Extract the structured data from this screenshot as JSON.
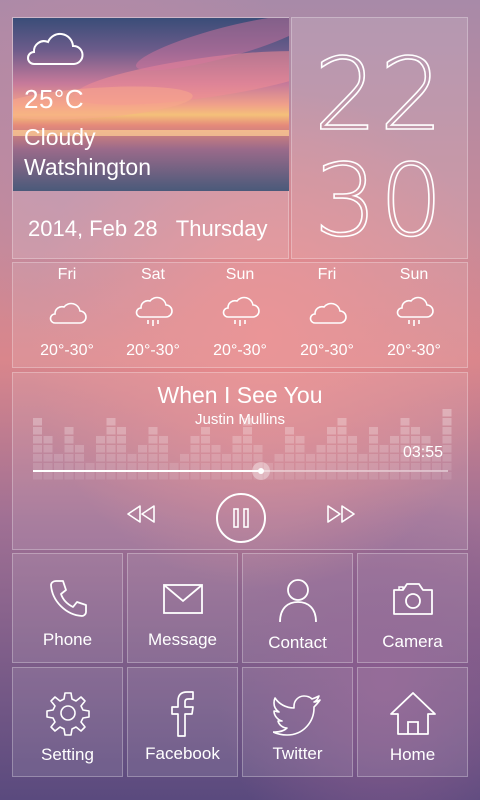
{
  "weather": {
    "temp": "25°C",
    "condition": "Cloudy",
    "city": "Watshington",
    "icon": "cloud-icon"
  },
  "date": {
    "text": "2014, Feb 28",
    "weekday": "Thursday"
  },
  "clock": {
    "hours": "22",
    "minutes": "30"
  },
  "forecast": [
    {
      "day": "Fri",
      "icon": "cloud-icon",
      "temp": "20°-30°"
    },
    {
      "day": "Sat",
      "icon": "rain-cloud-icon",
      "temp": "20°-30°"
    },
    {
      "day": "Sun",
      "icon": "rain-cloud-icon",
      "temp": "20°-30°"
    },
    {
      "day": "Fri",
      "icon": "cloud-icon",
      "temp": "20°-30°"
    },
    {
      "day": "Sun",
      "icon": "rain-cloud-icon",
      "temp": "20°-30°"
    }
  ],
  "music": {
    "title": "When I See You",
    "artist": "Justin Mullins",
    "time": "03:55",
    "progress": 0.55,
    "controls": {
      "prev": "rewind-icon",
      "play": "pause-icon",
      "next": "fast-forward-icon"
    }
  },
  "apps": [
    {
      "label": "Phone",
      "icon": "phone-icon"
    },
    {
      "label": "Message",
      "icon": "envelope-icon"
    },
    {
      "label": "Contact",
      "icon": "person-icon"
    },
    {
      "label": "Camera",
      "icon": "camera-icon"
    },
    {
      "label": "Setting",
      "icon": "gear-icon"
    },
    {
      "label": "Facebook",
      "icon": "facebook-icon"
    },
    {
      "label": "Twitter",
      "icon": "twitter-bird-icon"
    },
    {
      "label": "Home",
      "icon": "house-icon"
    }
  ]
}
